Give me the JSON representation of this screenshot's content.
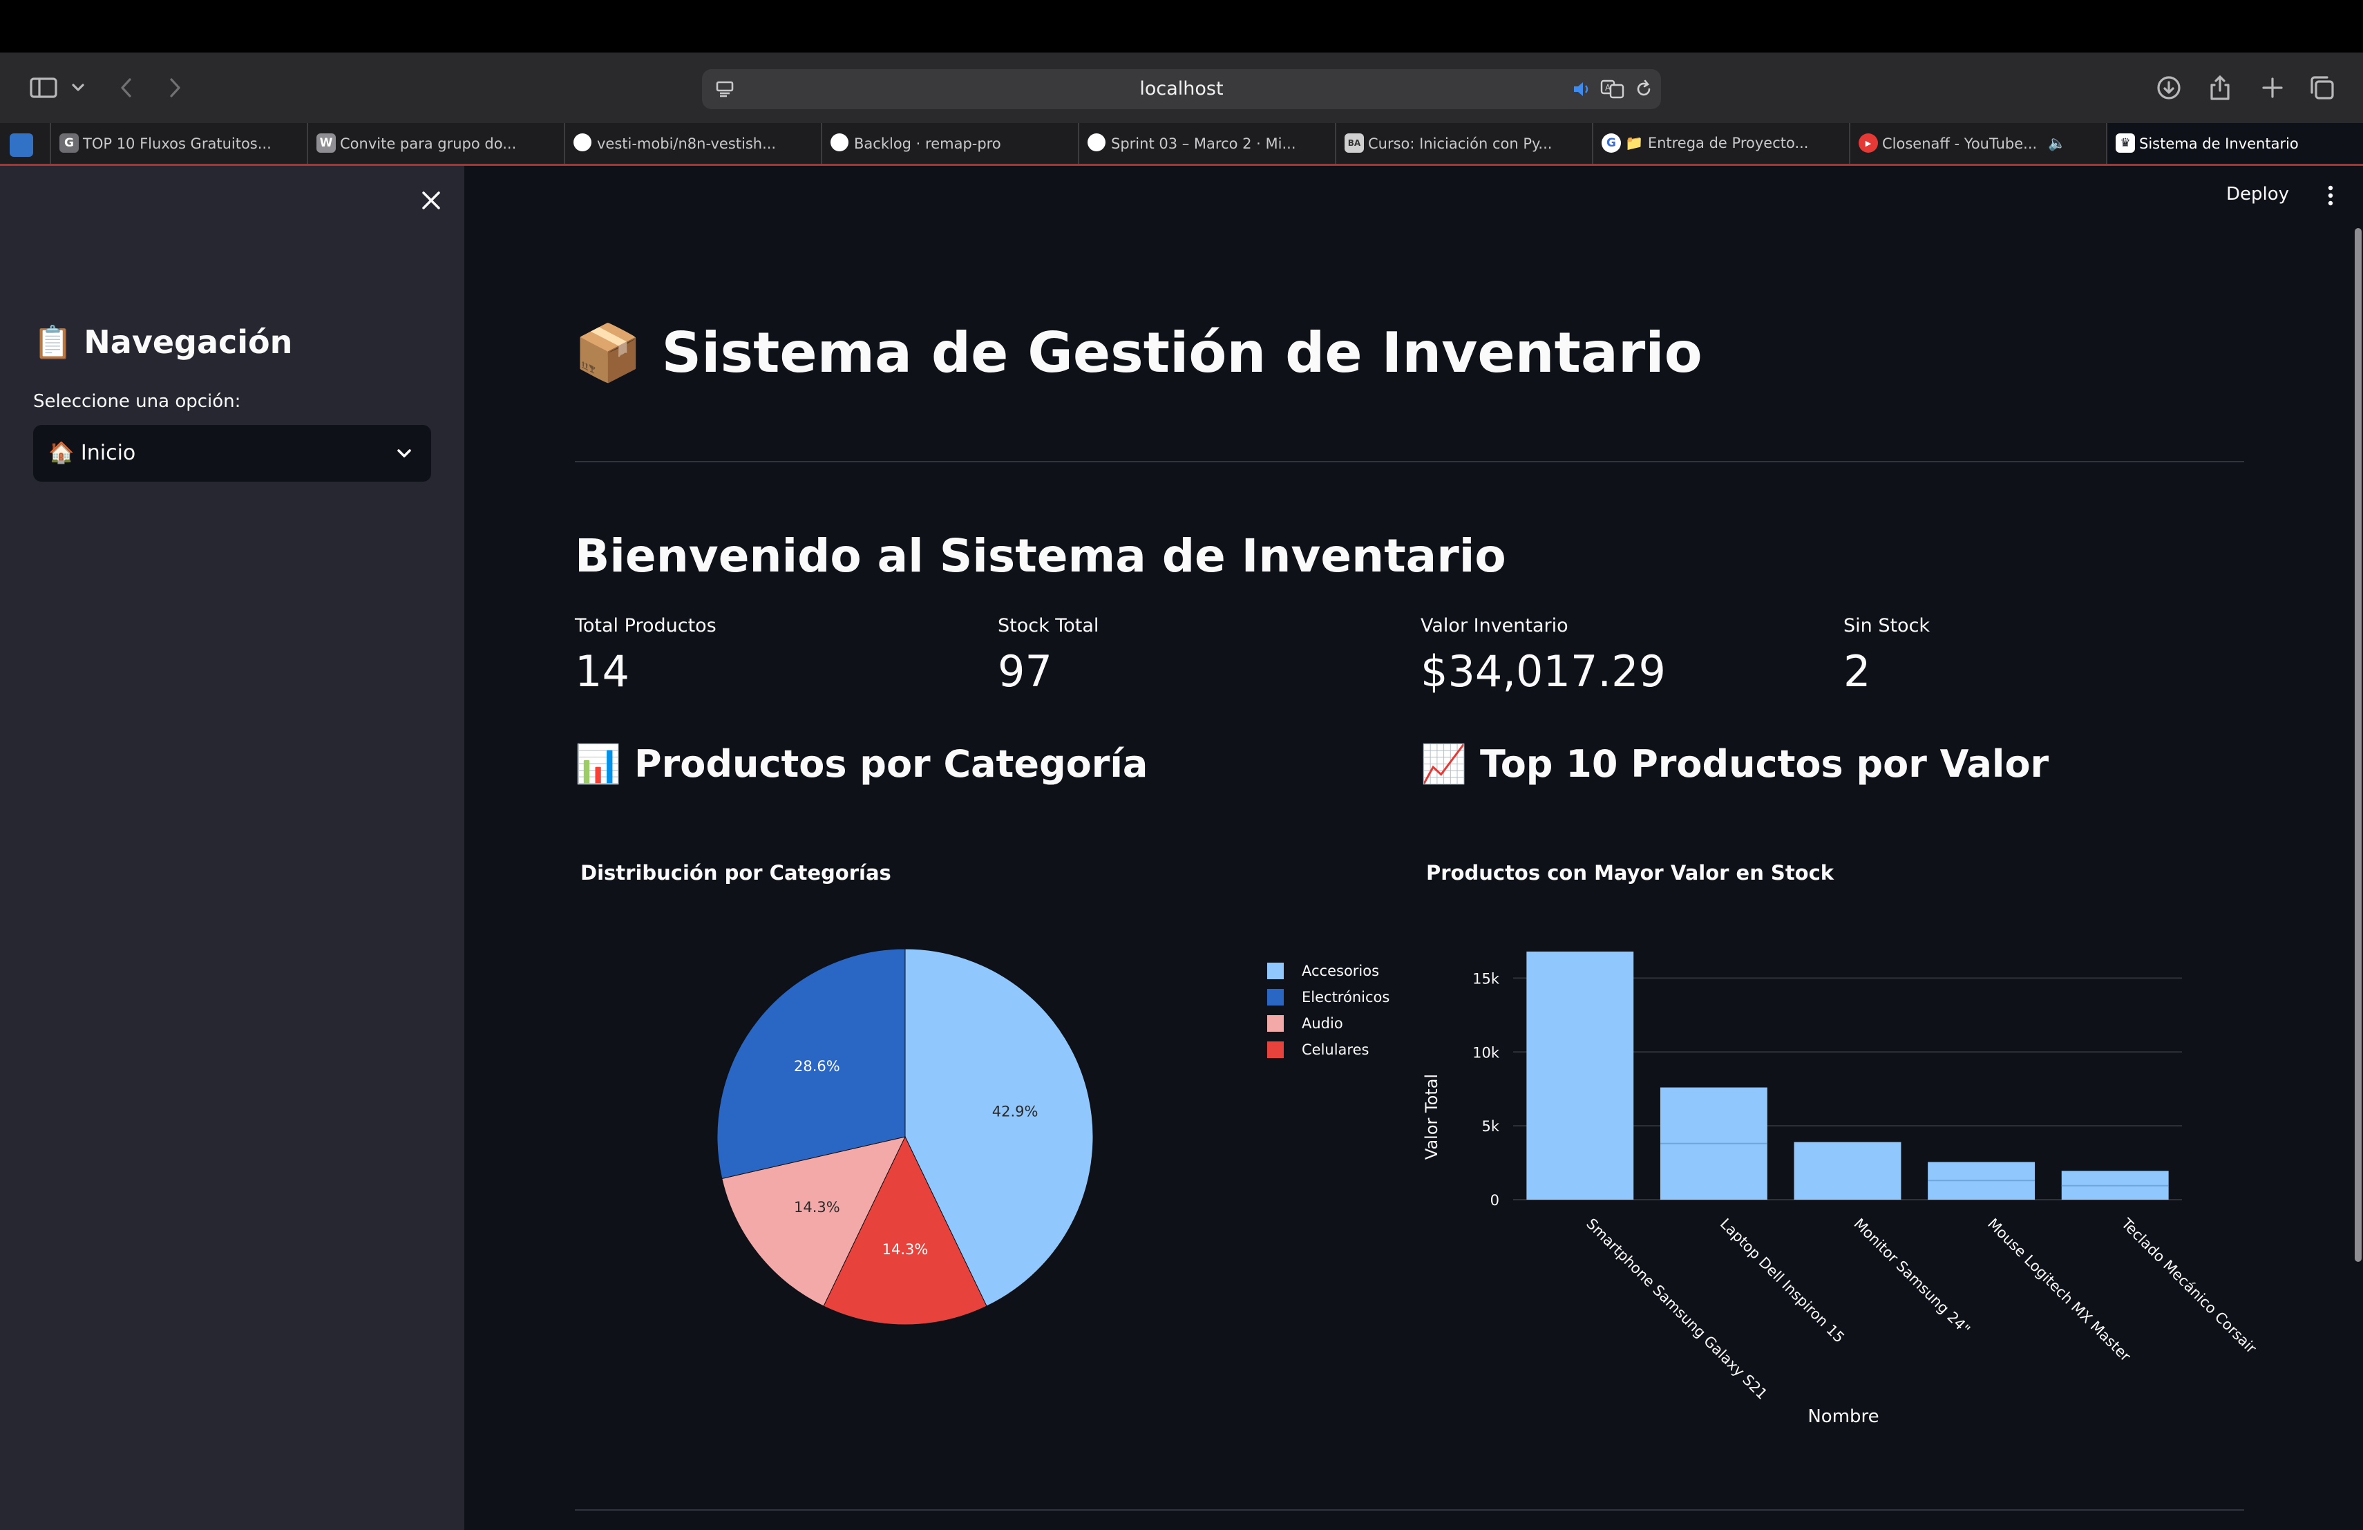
{
  "browser": {
    "url": "localhost",
    "tabs": [
      {
        "label": "TOP 10 Fluxos Gratuitos...",
        "fav": "G",
        "fav_color": "#6d6d72"
      },
      {
        "label": "Convite para grupo do...",
        "fav": "W",
        "fav_color": "#8e8e93"
      },
      {
        "label": "vesti-mobi/n8n-vestish...",
        "fav": "",
        "fav_color": "#ffffff"
      },
      {
        "label": "Backlog · remap-pro",
        "fav": "",
        "fav_color": "#ffffff"
      },
      {
        "label": "Sprint 03 – Marco 2 · Mi...",
        "fav": "",
        "fav_color": "#ffffff"
      },
      {
        "label": "Curso: Iniciación con Py...",
        "fav": "BA",
        "fav_color": "#d0d0d0"
      },
      {
        "label": "📁 Entrega de Proyecto...",
        "fav": "G",
        "fav_color": "#ffffff"
      },
      {
        "label": "Closenaff - YouTube...",
        "fav": "▶",
        "fav_color": "#e53935"
      },
      {
        "label": "Sistema de Inventario",
        "fav": "♛",
        "fav_color": "#ffffff"
      }
    ]
  },
  "sidebar": {
    "title": "📋 Navegación",
    "select_label": "Seleccione una opción:",
    "select_value": "🏠 Inicio"
  },
  "header": {
    "deploy_label": "Deploy"
  },
  "main": {
    "title": "📦 Sistema de Gestión de Inventario",
    "welcome": "Bienvenido al Sistema de Inventario",
    "metrics": [
      {
        "label": "Total Productos",
        "value": "14"
      },
      {
        "label": "Stock Total",
        "value": "97"
      },
      {
        "label": "Valor Inventario",
        "value": "$34,017.29"
      },
      {
        "label": "Sin Stock",
        "value": "2"
      }
    ],
    "section_left": "📊 Productos por Categoría",
    "section_right": "📈 Top 10 Productos por Valor"
  },
  "chart_data": [
    {
      "type": "pie",
      "title": "Distribución por Categorías",
      "labels": [
        "Accesorios",
        "Electrónicos",
        "Audio",
        "Celulares"
      ],
      "values": [
        42.9,
        28.6,
        14.3,
        14.3
      ],
      "value_labels": [
        "42.9%",
        "28.6%",
        "14.3%",
        "14.3%"
      ],
      "colors": [
        "#90c7fc",
        "#2a66c4",
        "#f2a9a8",
        "#e8423d"
      ],
      "legend": "right"
    },
    {
      "type": "bar",
      "title": "Productos con Mayor Valor en Stock",
      "xlabel": "Nombre",
      "ylabel": "Valor Total",
      "categories": [
        "Smartphone Samsung Galaxy S21",
        "Laptop Dell Inspiron 15",
        "Monitor Samsung 24\"",
        "Mouse Logitech MX Master",
        "Teclado Mecánico Corsair"
      ],
      "values": [
        16800,
        7600,
        3900,
        2550,
        1950
      ],
      "segment_lines": [
        [],
        [
          3800
        ],
        [],
        [
          1300
        ],
        [
          950
        ]
      ],
      "ylim": [
        0,
        17500
      ],
      "yticks": [
        0,
        5000,
        10000,
        15000
      ],
      "ytick_labels": [
        "0",
        "5k",
        "10k",
        "15k"
      ],
      "bar_color": "#90c7fc",
      "grid": true
    }
  ]
}
